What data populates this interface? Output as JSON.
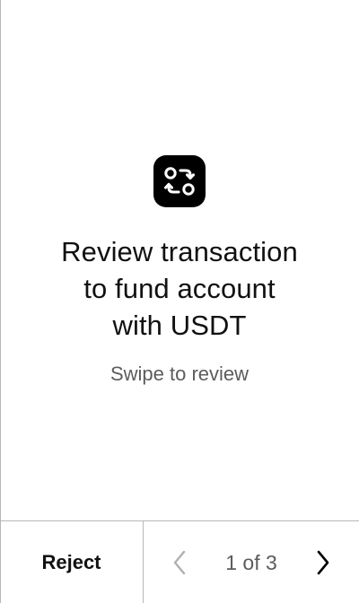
{
  "main": {
    "icon": "swap-arrows-icon",
    "title_lines": [
      "Review transaction",
      "to fund account",
      "with USDT"
    ],
    "subtitle": "Swipe to review"
  },
  "footer": {
    "reject_label": "Reject",
    "page_indicator": "1 of 3",
    "prev_icon": "chevron-left-icon",
    "next_icon": "chevron-right-icon"
  },
  "colors": {
    "text": "#111111",
    "muted": "#5c5c5c",
    "disabled": "#b0b0b0",
    "divider": "#b8b8b8",
    "icon_bg": "#000000"
  }
}
